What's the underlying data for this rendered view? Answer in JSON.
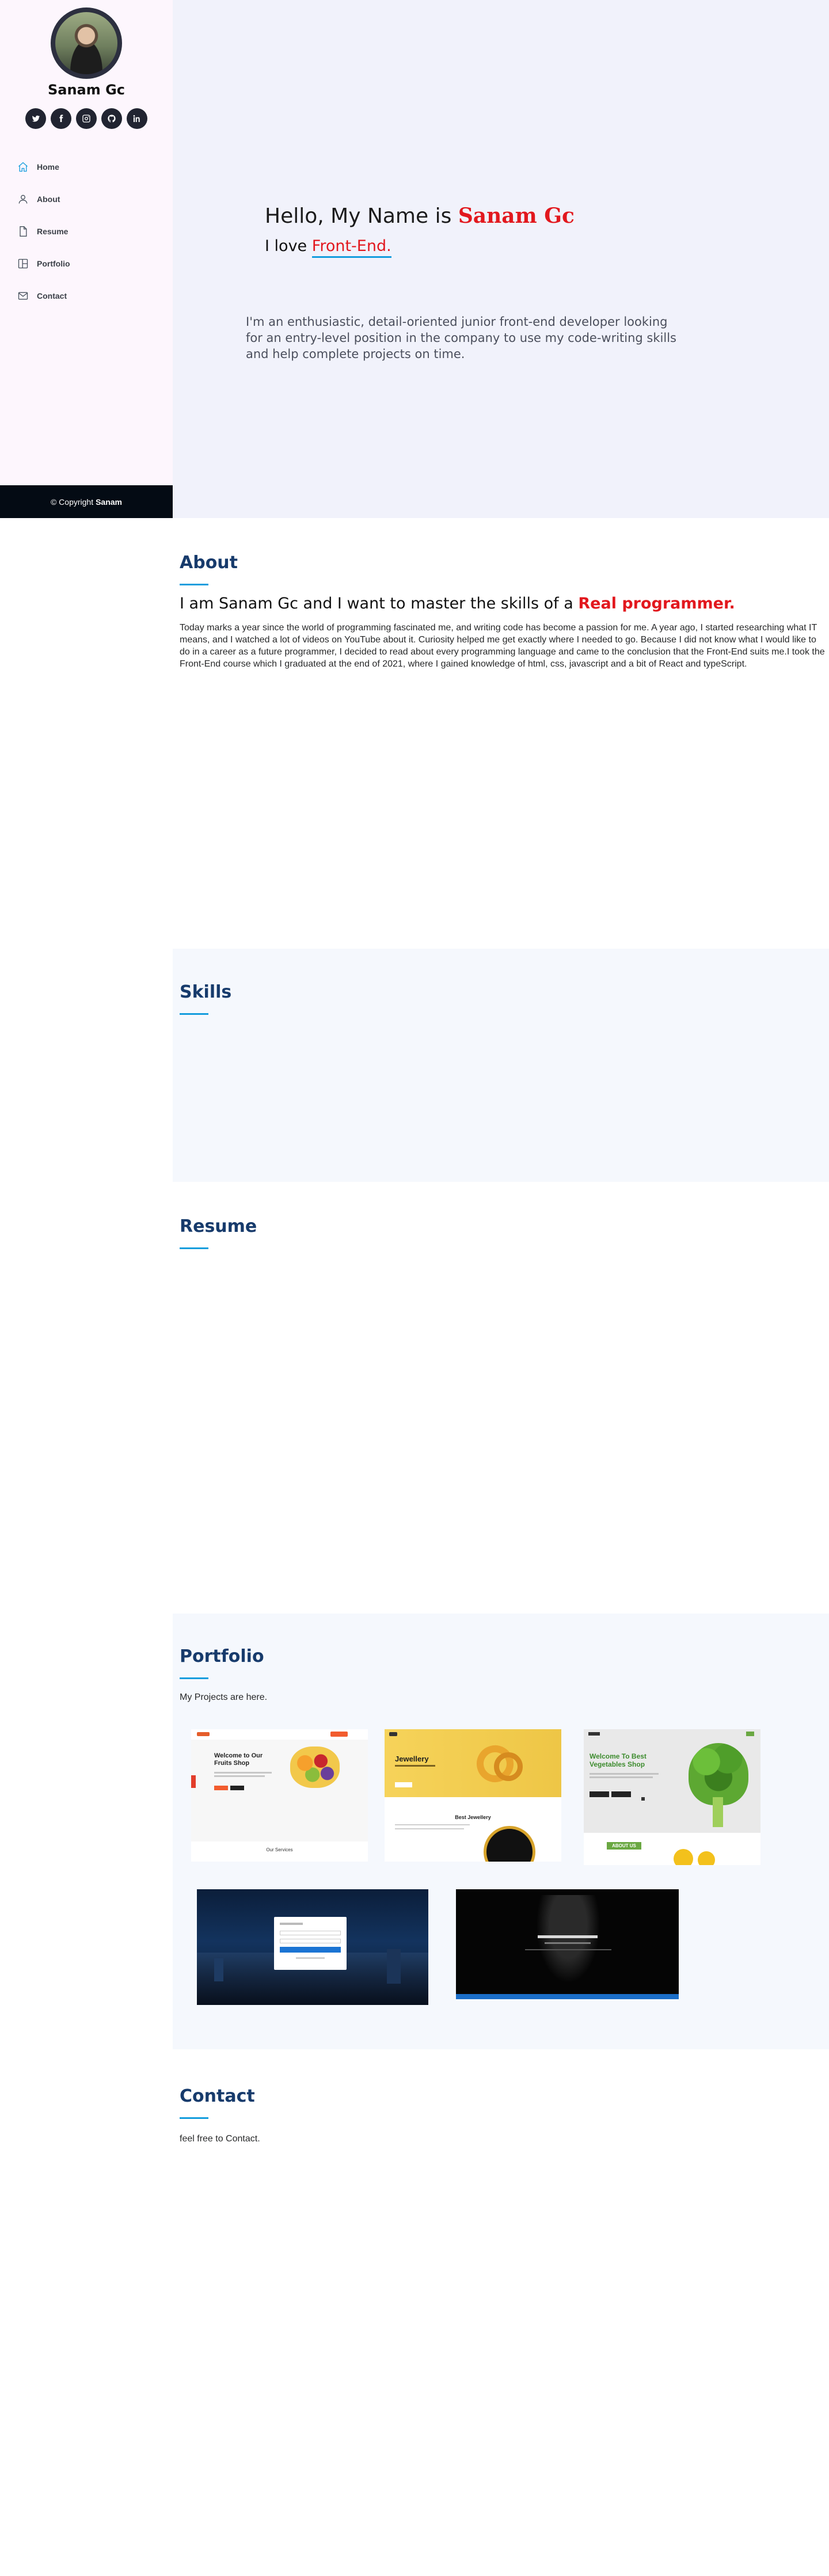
{
  "sidebar": {
    "name": "Sanam Gc",
    "socials": [
      "twitter-icon",
      "facebook-icon",
      "instagram-icon",
      "github-icon",
      "linkedin-icon"
    ],
    "nav": [
      {
        "label": "Home",
        "icon": "home-icon",
        "active": true
      },
      {
        "label": "About",
        "icon": "user-icon",
        "active": false
      },
      {
        "label": "Resume",
        "icon": "file-icon",
        "active": false
      },
      {
        "label": "Portfolio",
        "icon": "portfolio-icon",
        "active": false
      },
      {
        "label": "Contact",
        "icon": "envelope-icon",
        "active": false
      }
    ],
    "footer": {
      "prefix": "© Copyright",
      "owner": "Sanam"
    }
  },
  "hero": {
    "greeting": "Hello, My Name is",
    "name": "Sanam Gc",
    "love_prefix": "I love",
    "role": "Front-End.",
    "intro": "I'm an enthusiastic, detail-oriented junior front-end developer looking for an entry-level position in the company to use my code-writing skills and help complete projects on time."
  },
  "about": {
    "title": "About",
    "headline_prefix": "I am Sanam Gc and I want to master the skills of a",
    "headline_highlight": "Real programmer.",
    "body": "Today marks a year since the world of programming fascinated me, and writing code has become a passion for me. A year ago, I started researching what IT means, and I watched a lot of videos on YouTube about it. Curiosity helped me get exactly where I needed to go. Because I did not know what I would like to do in a career as a future programmer, I decided to read about every programming language and came to the conclusion that the Front-End suits me.I took the Front-End course which I graduated at the end of 2021, where I gained knowledge of html, css, javascript and a bit of React and typeScript."
  },
  "skills": {
    "title": "Skills"
  },
  "resume": {
    "title": "Resume"
  },
  "portfolio": {
    "title": "Portfolio",
    "subtitle": "My Projects are here.",
    "projects": [
      {
        "heading": "Welcome to Our Fruits Shop",
        "footer": "Our Services"
      },
      {
        "heading": "Jewellery",
        "footer": "Best Jewellery"
      },
      {
        "heading": "Welcome To Best Vegetables Shop",
        "footer": "ABOUT US"
      },
      {
        "heading": "",
        "footer": ""
      },
      {
        "heading": "",
        "footer": ""
      }
    ]
  },
  "contact": {
    "title": "Contact",
    "subtitle": "feel free to Contact."
  },
  "colors": {
    "accent": "#149ddd",
    "highlight": "#e2181e",
    "title": "#173b6c",
    "footer_bg": "#040b14"
  }
}
